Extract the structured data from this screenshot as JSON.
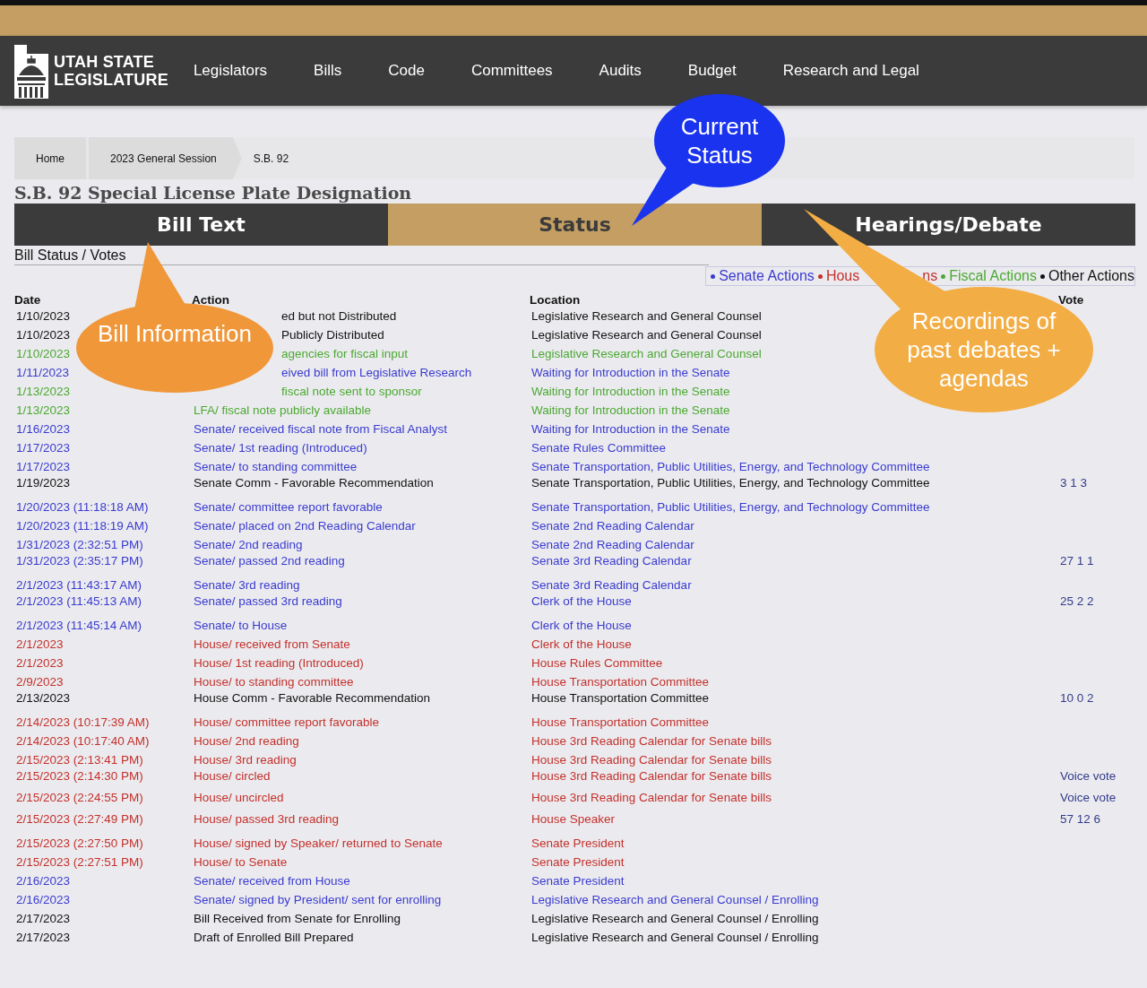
{
  "header": {
    "logo_line1": "UTAH STATE",
    "logo_line2": "LEGISLATURE",
    "nav": [
      "Legislators",
      "Bills",
      "Code",
      "Committees",
      "Audits",
      "Budget",
      "Research and Legal"
    ]
  },
  "breadcrumb": [
    "Home",
    "2023 General Session",
    "S.B. 92"
  ],
  "title": "S.B. 92 Special License Plate Designation",
  "tabs": [
    {
      "label": "Bill Text",
      "selected": false
    },
    {
      "label": "Status",
      "selected": true
    },
    {
      "label": "Hearings/Debate",
      "selected": false
    }
  ],
  "section_title": "Bill Status / Votes",
  "legend": [
    {
      "label": "Senate Actions",
      "color": "#3a3ad0"
    },
    {
      "label": "Hous",
      "label_end": "ns",
      "color": "#c4302b"
    },
    {
      "label": "Fiscal Actions",
      "color": "#4ca832"
    },
    {
      "label": "Other Actions",
      "color": "#111111"
    }
  ],
  "table": {
    "columns": [
      "Date",
      "Action",
      "Location",
      "Vote"
    ],
    "rows": [
      {
        "date": "1/10/2023",
        "action": "ed but not Distributed",
        "occluded": true,
        "location": "Legislative Research and General Counsel",
        "color": "#111111"
      },
      {
        "date": "1/10/2023",
        "action": "Publicly Distributed",
        "occluded": true,
        "location": "Legislative Research and General Counsel",
        "color": "#111111"
      },
      {
        "date": "1/10/2023",
        "action": "agencies for fiscal input",
        "occluded": true,
        "location": "Legislative Research and General Counsel",
        "color": "#4ca832"
      },
      {
        "date": "1/11/2023",
        "action": "eived bill from Legislative Research",
        "occluded": true,
        "location": "Waiting for Introduction in the Senate",
        "color": "#3a3ad0"
      },
      {
        "date": "1/13/2023",
        "action": "fiscal note sent to sponsor",
        "occluded": true,
        "location": "Waiting for Introduction in the Senate",
        "color": "#4ca832"
      },
      {
        "date": "1/13/2023",
        "action": "LFA/ fiscal note publicly available",
        "location": "Waiting for Introduction in the Senate",
        "color": "#4ca832"
      },
      {
        "date": "1/16/2023",
        "action": "Senate/ received fiscal note from Fiscal Analyst",
        "location": "Waiting for Introduction in the Senate",
        "color": "#3a3ad0"
      },
      {
        "date": "1/17/2023",
        "action": "Senate/ 1st reading (Introduced)",
        "location": "Senate Rules Committee",
        "color": "#3a3ad0"
      },
      {
        "date": "1/17/2023",
        "action": "Senate/ to standing committee",
        "location": "Senate Transportation, Public Utilities, Energy, and Technology Committee",
        "color": "#3a3ad0"
      },
      {
        "date": "1/19/2023",
        "action": "Senate Comm - Favorable Recommendation",
        "location": "Senate Transportation, Public Utilities, Energy, and Technology Committee",
        "vote": "3 1 3",
        "color": "#111111"
      },
      {
        "date": "1/20/2023 (11:18:18 AM)",
        "action": "Senate/ committee report favorable",
        "location": "Senate Transportation, Public Utilities, Energy, and Technology Committee",
        "color": "#3a3ad0"
      },
      {
        "date": "1/20/2023 (11:18:19 AM)",
        "action": "Senate/ placed on 2nd Reading Calendar",
        "location": "Senate 2nd Reading Calendar",
        "color": "#3a3ad0"
      },
      {
        "date": "1/31/2023 (2:32:51 PM)",
        "action": "Senate/ 2nd reading",
        "location": "Senate 2nd Reading Calendar",
        "color": "#3a3ad0"
      },
      {
        "date": "1/31/2023 (2:35:17 PM)",
        "action": "Senate/ passed 2nd reading",
        "location": "Senate 3rd Reading Calendar",
        "vote": "27 1 1",
        "color": "#3a3ad0"
      },
      {
        "date": "2/1/2023 (11:43:17 AM)",
        "action": "Senate/ 3rd reading",
        "location": "Senate 3rd Reading Calendar",
        "color": "#3a3ad0"
      },
      {
        "date": "2/1/2023 (11:45:13 AM)",
        "action": "Senate/ passed 3rd reading",
        "location": "Clerk of the House",
        "vote": "25 2 2",
        "color": "#3a3ad0"
      },
      {
        "date": "2/1/2023 (11:45:14 AM)",
        "action": "Senate/ to House",
        "location": "Clerk of the House",
        "color": "#3a3ad0"
      },
      {
        "date": "2/1/2023",
        "action": "House/ received from Senate",
        "location": "Clerk of the House",
        "color": "#c4302b"
      },
      {
        "date": "2/1/2023",
        "action": "House/ 1st reading (Introduced)",
        "location": "House Rules Committee",
        "color": "#c4302b"
      },
      {
        "date": "2/9/2023",
        "action": "House/ to standing committee",
        "location": "House Transportation Committee",
        "color": "#c4302b"
      },
      {
        "date": "2/13/2023",
        "action": "House Comm - Favorable Recommendation",
        "location": "House Transportation Committee",
        "vote": "10 0 2",
        "color": "#111111"
      },
      {
        "date": "2/14/2023 (10:17:39 AM)",
        "action": "House/ committee report favorable",
        "location": "House Transportation Committee",
        "color": "#c4302b"
      },
      {
        "date": "2/14/2023 (10:17:40 AM)",
        "action": "House/ 2nd reading",
        "location": "House 3rd Reading Calendar for Senate bills",
        "color": "#c4302b"
      },
      {
        "date": "2/15/2023 (2:13:41 PM)",
        "action": "House/ 3rd reading",
        "location": "House 3rd Reading Calendar for Senate bills",
        "color": "#c4302b"
      },
      {
        "date": "2/15/2023 (2:14:30 PM)",
        "action": "House/ circled",
        "location": "House 3rd Reading Calendar for Senate bills",
        "vote": "Voice vote",
        "color": "#c4302b"
      },
      {
        "date": "2/15/2023 (2:24:55 PM)",
        "action": "House/ uncircled",
        "location": "House 3rd Reading Calendar for Senate bills",
        "vote": "Voice vote",
        "color": "#c4302b"
      },
      {
        "date": "2/15/2023 (2:27:49 PM)",
        "action": "House/ passed 3rd reading",
        "location": "House Speaker",
        "vote": "57 12 6",
        "color": "#c4302b"
      },
      {
        "date": "2/15/2023 (2:27:50 PM)",
        "action": "House/ signed by Speaker/ returned to Senate",
        "location": "Senate President",
        "color": "#c4302b"
      },
      {
        "date": "2/15/2023 (2:27:51 PM)",
        "action": "House/ to Senate",
        "location": "Senate President",
        "color": "#c4302b"
      },
      {
        "date": "2/16/2023",
        "action": "Senate/ received from House",
        "location": "Senate President",
        "color": "#3a3ad0"
      },
      {
        "date": "2/16/2023",
        "action": "Senate/ signed by President/ sent for enrolling",
        "location": "Legislative Research and General Counsel / Enrolling",
        "color": "#3a3ad0"
      },
      {
        "date": "2/17/2023",
        "action": "Bill Received from Senate for Enrolling",
        "location": "Legislative Research and General Counsel / Enrolling",
        "color": "#111111"
      },
      {
        "date": "2/17/2023",
        "action": "Draft of Enrolled Bill Prepared",
        "location": "Legislative Research and General Counsel / Enrolling",
        "color": "#111111"
      }
    ]
  },
  "callouts": [
    {
      "kind": "status",
      "text": "Current Status",
      "color": "#1a33ee"
    },
    {
      "kind": "bill",
      "text": "Bill Information",
      "color": "#f0973a"
    },
    {
      "kind": "hearings",
      "text": "Recordings of past debates + agendas",
      "color": "#f3ad45"
    }
  ]
}
